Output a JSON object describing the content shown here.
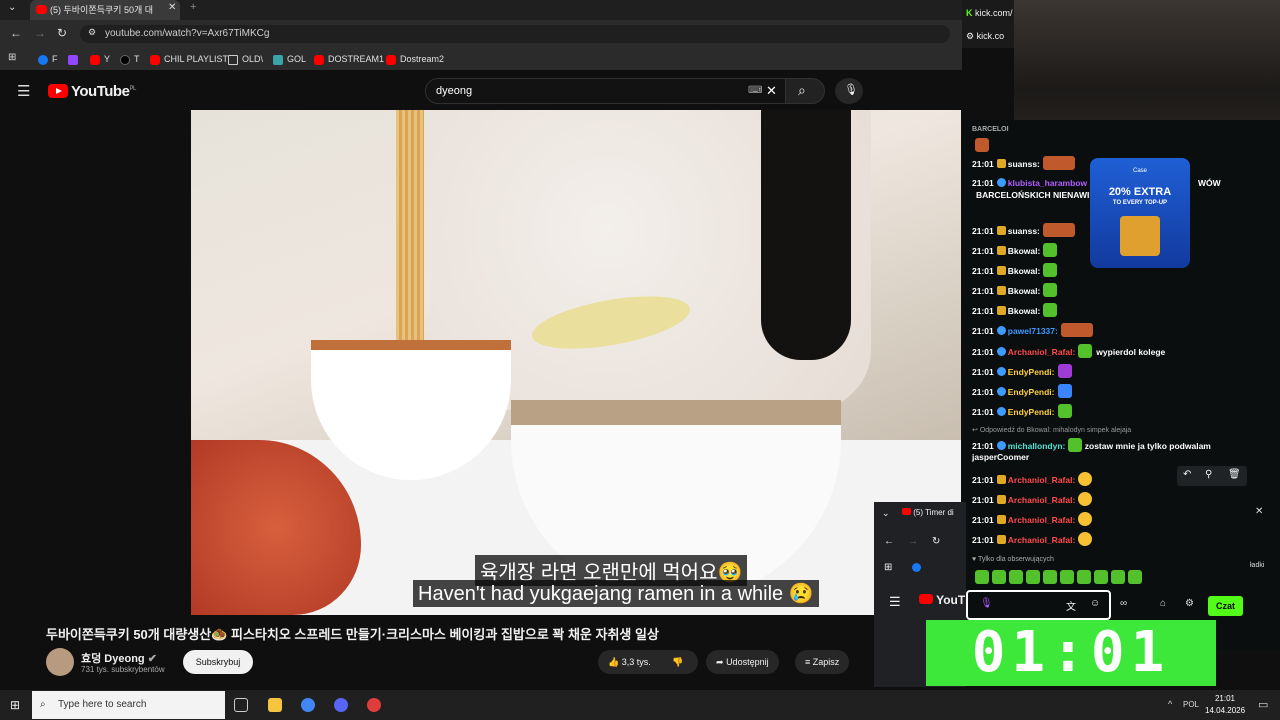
{
  "browser": {
    "tab_title": "(5) 두바이쫀득쿠키 50개 대",
    "url": "youtube.com/watch?v=Axr67TiMKCg",
    "bookmarks": [
      "F",
      "Y",
      "T",
      "CHIL PLAYLIST",
      "OLD\\",
      "GOL",
      "DOSTREAM1",
      "Dostream2"
    ]
  },
  "kick": {
    "tab1": "kick.com/",
    "tab2": "kick.co"
  },
  "youtube": {
    "logo": "YouTube",
    "region": "PL",
    "search_value": "dyeong",
    "caption_kr": "육개장 라면 오랜만에 먹어요🥹",
    "caption_en": "Haven't had yukgaejang ramen in a while 😢",
    "video_title": "두바이쫀득쿠키 50개 대량생산🧆 피스타치오 스프레드 만들기·크리스마스 베이킹과 집밥으로 꽉 채운 자취생 일상",
    "channel_name": "효덩 Dyeong",
    "subscribers": "731 tys. subskrybentów",
    "subscribe_label": "Subskrybuj",
    "likes": "3,3 tys.",
    "share_label": "Udostępnij",
    "save_label": "Zapisz"
  },
  "chat": {
    "top_label": "BARCELOI",
    "messages": [
      {
        "time": "21:01",
        "user": "suanss:",
        "text": "",
        "user_color": "#ffffff"
      },
      {
        "time": "21:01",
        "user": "klubista_harambow",
        "text": "WÓW",
        "user_color": "#b05cff"
      },
      {
        "time": "",
        "user": "",
        "text": "BARCELOŃSKICH NIENAWID",
        "user_color": "#ffffff"
      },
      {
        "time": "21:01",
        "user": "suanss:",
        "text": "",
        "user_color": "#ffffff"
      },
      {
        "time": "21:01",
        "user": "Bkowal:",
        "text": "",
        "user_color": "#ffffff"
      },
      {
        "time": "21:01",
        "user": "Bkowal:",
        "text": "",
        "user_color": "#ffffff"
      },
      {
        "time": "21:01",
        "user": "Bkowal:",
        "text": "",
        "user_color": "#ffffff"
      },
      {
        "time": "21:01",
        "user": "Bkowal:",
        "text": "",
        "user_color": "#ffffff"
      },
      {
        "time": "21:01",
        "user": "pawel71337:",
        "text": "",
        "user_color": "#3b9bff"
      },
      {
        "time": "21:01",
        "user": "Archaniol_Rafal:",
        "text": "wypierdol kolege",
        "user_color": "#ff4b4b"
      },
      {
        "time": "21:01",
        "user": "EndyPendi:",
        "text": "",
        "user_color": "#ffd23f"
      },
      {
        "time": "21:01",
        "user": "EndyPendi:",
        "text": "",
        "user_color": "#ffd23f"
      },
      {
        "time": "21:01",
        "user": "EndyPendi:",
        "text": "",
        "user_color": "#ffd23f"
      }
    ],
    "reply_ref": "Odpowiedź do Bkowal: mihalodyn simpek alejaja",
    "reply_msg": {
      "time": "21:01",
      "user": "michallondyn:",
      "text": "zostaw mnie ja tylko podwalam",
      "cont": "jasperCoomer"
    },
    "rafal_msgs": [
      {
        "time": "21:01",
        "user": "Archaniol_Rafal:"
      },
      {
        "time": "21:01",
        "user": "Archaniol_Rafal:"
      },
      {
        "time": "21:01",
        "user": "Archaniol_Rafal:"
      },
      {
        "time": "21:01",
        "user": "Archaniol_Rafal:"
      }
    ],
    "followers_only": "Tylko dla obserwujących",
    "send_label": "Czat",
    "ad_line1": "20% EXTRA",
    "ad_line2": "TO EVERY TOP-UP",
    "ad_brand": "Case"
  },
  "popup": {
    "tab_title": "(5) Timer di",
    "side": "ładki"
  },
  "timer": "01:01",
  "taskbar": {
    "search_placeholder": "Type here to search",
    "lang": "POL",
    "time": "21:01",
    "date": "14.04.2026"
  }
}
